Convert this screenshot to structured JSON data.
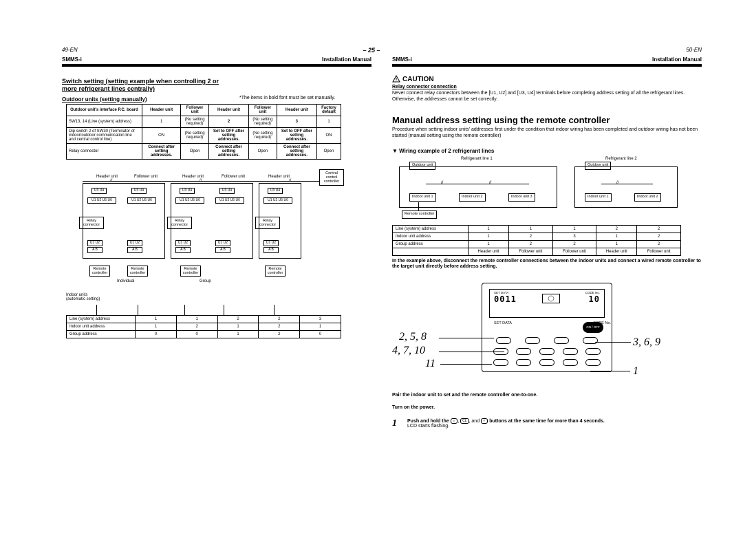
{
  "center_page": "– 25 –",
  "left": {
    "top_page": "49-EN",
    "smms": "SMMS-i",
    "manual": "Installation Manual",
    "title": "Switch setting (setting example when controlling 2 or more refrigerant lines centrally)",
    "title_note": "*The items in bold font must be set manually.",
    "sub": "Outdoor units (setting manually)",
    "settings_header": [
      "Outdoor unit's interface P.C. board",
      "Header unit",
      "Follower unit",
      "Header unit",
      "Follower unit",
      "Header unit",
      "Factory default"
    ],
    "settings_rows": [
      {
        "label": "SW13, 14\n(Line (system) address)",
        "c": [
          "1",
          "(No setting required)",
          "2",
          "(No setting required)",
          "3",
          "1"
        ],
        "bold_idx": [
          2,
          4
        ]
      },
      {
        "label": "Dip switch 2 of SW30 (Terminator of indoor/outdoor communication line and central control line)",
        "c": [
          "ON",
          "(No setting required)",
          "Set to OFF after setting addresses.",
          "(No setting required)",
          "Set to OFF after setting addresses.",
          "ON"
        ],
        "bold_idx": [
          2,
          4
        ]
      },
      {
        "label": "Relay connector",
        "c": [
          "Connect after setting addresses.",
          "Open",
          "Connect after setting addresses.",
          "Open",
          "Connect after setting addresses.",
          "Open"
        ],
        "bold_idx": [
          0,
          2,
          4
        ]
      }
    ],
    "unit_labels": {
      "header": "Header unit",
      "follower": "Follower unit"
    },
    "terminal_top": "U3 U4",
    "terminal_bot": "U1 U2 U5 U6",
    "ab": "A   B",
    "ccontrol": "Central control controller",
    "relay": "Relay connector",
    "remote": "Remote controller",
    "group_labels": {
      "individual": "Individual",
      "group": "Group"
    },
    "indoor_note": "Indoor units\n(automatic setting)",
    "addr_header": [
      "Line (system) address",
      "Indoor unit address",
      "Group address"
    ],
    "addr_rows": [
      [
        "1",
        "1",
        "2",
        "2",
        "3"
      ],
      [
        "1",
        "2",
        "1",
        "2",
        "1"
      ],
      [
        "0",
        "0",
        "1",
        "2",
        "0"
      ]
    ]
  },
  "right": {
    "top_page": "50-EN",
    "smms": "SMMS-i",
    "manual": "Installation Manual",
    "caution": "CAUTION",
    "caution_title": "Relay connector connection",
    "caution_body": "Never connect relay connectors between the [U1, U2] and [U3, U4] terminals before completing address setting of all the refrigerant lines. Otherwise, the addresses cannot be set correctly.",
    "section_title": "Manual address setting using the remote controller",
    "section_body": "Procedure when setting indoor units' addresses first under the condition that indoor wiring has been completed and outdoor wiring has not been started (manual setting using the remote controller)",
    "wiring_title": "▼ Wiring example of 2 refrigerant lines",
    "ref1": "Refrigerant line 1",
    "ref2": "Refrigerant line 2",
    "outdoor": "Outdoor unit",
    "indoor_prefix": "Indoor unit ",
    "remote": "Remote controller",
    "addr2_rows": [
      {
        "label": "Line (system) address",
        "c": [
          "1",
          "1",
          "1",
          "2",
          "2"
        ]
      },
      {
        "label": "Indoor unit address",
        "c": [
          "1",
          "2",
          "3",
          "1",
          "2"
        ]
      },
      {
        "label": "Group address",
        "c": [
          "1",
          "2",
          "2",
          "1",
          "2"
        ]
      },
      {
        "label": "",
        "c": [
          "Header unit",
          "Follower unit",
          "Follower unit",
          "Header unit",
          "Follower unit"
        ]
      }
    ],
    "example_note": "In the example above, disconnect the remote controller connections between the indoor units and connect a wired remote controller to the target unit directly before address setting.",
    "callouts": {
      "a": "2, 5, 8",
      "b": "4, 7, 10",
      "c": "11",
      "d": "3, 6, 9",
      "e": "1"
    },
    "setdata": "SET DATA",
    "codeno": "CODE No.",
    "seg_left": "0011",
    "seg_right": "10",
    "onoff": "ON / OFF",
    "pair_note": "Pair the indoor unit to set and the remote controller one-to-one.",
    "turnon": "Turn on the power.",
    "step1_num": "1",
    "step1_text_a": "Push and hold the ",
    "step1_text_b": " buttons at the same time for more than 4 seconds.",
    "step1_tail": "LCD starts flashing.",
    "step1_and": ", and ",
    "btns": [
      "☼",
      "CL",
      "✓"
    ]
  }
}
